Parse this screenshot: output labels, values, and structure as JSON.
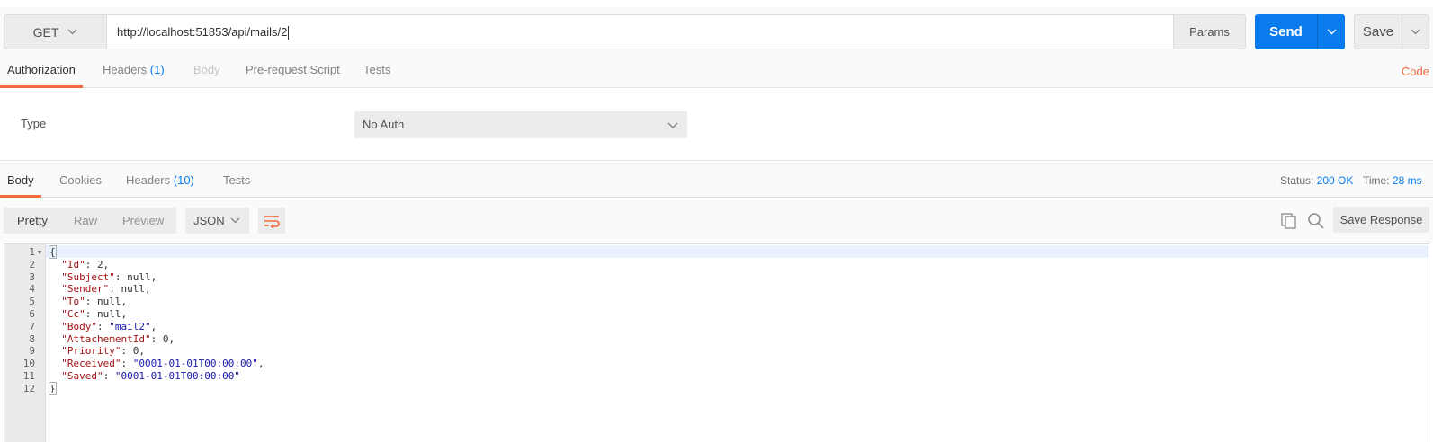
{
  "request": {
    "method": "GET",
    "url": "http://localhost:51853/api/mails/2",
    "params_label": "Params",
    "send_label": "Send",
    "save_label": "Save"
  },
  "request_tabs": [
    {
      "label": "Authorization",
      "count": "",
      "state": "active"
    },
    {
      "label": "Headers",
      "count": "(1)",
      "state": "normal"
    },
    {
      "label": "Body",
      "count": "",
      "state": "disabled"
    },
    {
      "label": "Pre-request Script",
      "count": "",
      "state": "normal"
    },
    {
      "label": "Tests",
      "count": "",
      "state": "normal"
    }
  ],
  "code_link": "Code",
  "auth": {
    "type_label": "Type",
    "selected": "No Auth"
  },
  "response_tabs": [
    {
      "label": "Body",
      "count": "",
      "state": "active"
    },
    {
      "label": "Cookies",
      "count": "",
      "state": "normal"
    },
    {
      "label": "Headers",
      "count": "(10)",
      "state": "normal"
    },
    {
      "label": "Tests",
      "count": "",
      "state": "normal"
    }
  ],
  "response_status": {
    "status_label": "Status:",
    "status_value": "200 OK",
    "time_label": "Time:",
    "time_value": "28 ms"
  },
  "response_toolbar": {
    "views": [
      "Pretty",
      "Raw",
      "Preview"
    ],
    "format": "JSON",
    "save_response_label": "Save Response"
  },
  "response_body": [
    {
      "num": "1",
      "fold": true,
      "tokens": [
        {
          "t": "{",
          "c": "n"
        }
      ]
    },
    {
      "num": "2",
      "tokens": [
        {
          "t": "  \"Id\"",
          "c": "k"
        },
        {
          "t": ": 2,",
          "c": "n"
        }
      ]
    },
    {
      "num": "3",
      "tokens": [
        {
          "t": "  \"Subject\"",
          "c": "k"
        },
        {
          "t": ": null,",
          "c": "n"
        }
      ]
    },
    {
      "num": "4",
      "tokens": [
        {
          "t": "  \"Sender\"",
          "c": "k"
        },
        {
          "t": ": null,",
          "c": "n"
        }
      ]
    },
    {
      "num": "5",
      "tokens": [
        {
          "t": "  \"To\"",
          "c": "k"
        },
        {
          "t": ": null,",
          "c": "n"
        }
      ]
    },
    {
      "num": "6",
      "tokens": [
        {
          "t": "  \"Cc\"",
          "c": "k"
        },
        {
          "t": ": null,",
          "c": "n"
        }
      ]
    },
    {
      "num": "7",
      "tokens": [
        {
          "t": "  \"Body\"",
          "c": "k"
        },
        {
          "t": ": ",
          "c": "n"
        },
        {
          "t": "\"mail2\"",
          "c": "s"
        },
        {
          "t": ",",
          "c": "n"
        }
      ]
    },
    {
      "num": "8",
      "tokens": [
        {
          "t": "  \"AttachementId\"",
          "c": "k"
        },
        {
          "t": ": 0,",
          "c": "n"
        }
      ]
    },
    {
      "num": "9",
      "tokens": [
        {
          "t": "  \"Priority\"",
          "c": "k"
        },
        {
          "t": ": 0,",
          "c": "n"
        }
      ]
    },
    {
      "num": "10",
      "tokens": [
        {
          "t": "  \"Received\"",
          "c": "k"
        },
        {
          "t": ": ",
          "c": "n"
        },
        {
          "t": "\"0001-01-01T00:00:00\"",
          "c": "s"
        },
        {
          "t": ",",
          "c": "n"
        }
      ]
    },
    {
      "num": "11",
      "tokens": [
        {
          "t": "  \"Saved\"",
          "c": "k"
        },
        {
          "t": ": ",
          "c": "n"
        },
        {
          "t": "\"0001-01-01T00:00:00\"",
          "c": "s"
        }
      ]
    },
    {
      "num": "12",
      "tokens": [
        {
          "t": "}",
          "c": "n"
        }
      ]
    }
  ],
  "colors": {
    "accent": "#097bed",
    "tab_indicator": "#f26b3a"
  }
}
